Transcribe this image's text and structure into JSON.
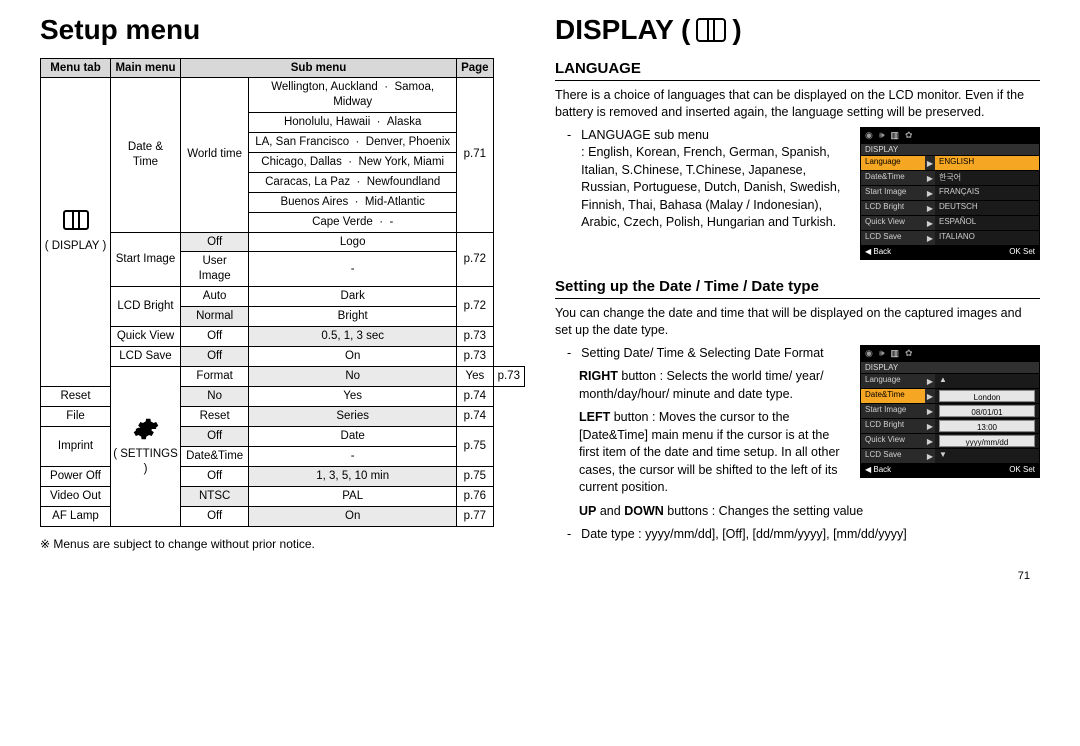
{
  "page_number": "71",
  "left": {
    "title": "Setup menu",
    "headers": [
      "Menu tab",
      "Main menu",
      "Sub menu",
      "Page"
    ],
    "display_tab_label": "( DISPLAY )",
    "display_rows": {
      "date_time": {
        "main": "Date & Time",
        "sub_main": "World time",
        "cities": [
          [
            "Wellington, Auckland",
            "Samoa, Midway"
          ],
          [
            "Honolulu, Hawaii",
            "Alaska"
          ],
          [
            "LA, San Francisco",
            "Denver, Phoenix"
          ],
          [
            "Chicago, Dallas",
            "New York, Miami"
          ],
          [
            "Caracas, La Paz",
            "Newfoundland"
          ],
          [
            "Buenos Aires",
            "Mid-Atlantic"
          ],
          [
            "Cape Verde",
            "-"
          ]
        ],
        "page": "p.71"
      },
      "start_image": {
        "main": "Start Image",
        "r1": [
          "Off",
          "Logo"
        ],
        "r2": [
          "User Image",
          "-"
        ],
        "page": "p.72"
      },
      "lcd_bright": {
        "main": "LCD Bright",
        "r1": [
          "Auto",
          "Dark"
        ],
        "r2": [
          "Normal",
          "Bright"
        ],
        "page": "p.72"
      },
      "quick_view": {
        "main": "Quick View",
        "r1": [
          "Off",
          "0.5, 1, 3 sec"
        ],
        "page": "p.73"
      },
      "lcd_save": {
        "main": "LCD Save",
        "r1": [
          "Off",
          "On"
        ],
        "page": "p.73"
      }
    },
    "settings_tab_label": "( SETTINGS )",
    "settings_rows": {
      "format": {
        "main": "Format",
        "r1": [
          "No",
          "Yes"
        ],
        "page": "p.73"
      },
      "reset": {
        "main": "Reset",
        "r1": [
          "No",
          "Yes"
        ],
        "page": "p.74"
      },
      "file": {
        "main": "File",
        "r1": [
          "Reset",
          "Series"
        ],
        "page": "p.74"
      },
      "imprint": {
        "main": "Imprint",
        "r1": [
          "Off",
          "Date"
        ],
        "r2": [
          "Date&Time",
          "-"
        ],
        "page": "p.75"
      },
      "power_off": {
        "main": "Power Off",
        "r1": [
          "Off",
          "1, 3, 5, 10 min"
        ],
        "page": "p.75"
      },
      "video_out": {
        "main": "Video Out",
        "r1": [
          "NTSC",
          "PAL"
        ],
        "page": "p.76"
      },
      "af_lamp": {
        "main": "AF Lamp",
        "r1": [
          "Off",
          "On"
        ],
        "page": "p.77"
      }
    },
    "note": "※  Menus are subject to change without prior notice."
  },
  "right": {
    "title": "DISPLAY (",
    "title_close": ")",
    "language": {
      "heading": "LANGUAGE",
      "para": "There is a choice of languages that can be displayed on the LCD monitor. Even if the battery is removed and inserted again, the language setting will be preserved.",
      "bullet_label": "LANGUAGE sub menu",
      "bullet_body": ": English, Korean, French, German, Spanish, Italian, S.Chinese, T.Chinese, Japanese, Russian, Portuguese, Dutch, Danish, Swedish, Finnish, Thai, Bahasa (Malay / Indonesian), Arabic, Czech, Polish, Hungarian and Turkish.",
      "lcd": {
        "title": "DISPLAY",
        "items": [
          {
            "label": "Language",
            "value": "ENGLISH",
            "active": true,
            "valActive": true
          },
          {
            "label": "Date&Time",
            "value": "한국어"
          },
          {
            "label": "Start Image",
            "value": "FRANÇAIS"
          },
          {
            "label": "LCD Bright",
            "value": "DEUTSCH"
          },
          {
            "label": "Quick View",
            "value": "ESPAÑOL"
          },
          {
            "label": "LCD Save",
            "value": "ITALIANO"
          }
        ],
        "foot_left": "◀  Back",
        "foot_right": "OK  Set"
      }
    },
    "datetime": {
      "heading": "Setting up the Date / Time / Date type",
      "para": "You can change the date and time that will be displayed on the captured images and set up the date type.",
      "b1": "Setting Date/ Time & Selecting Date Format",
      "b2a": "RIGHT",
      "b2b": " button : Selects the world time/ year/ month/day/hour/ minute and date type.",
      "b3a": "LEFT",
      "b3b": " button    : Moves the cursor to the [Date&Time] main menu if the cursor is at the first item of the date and time setup. In all other cases, the cursor will be shifted to the left of its current position.",
      "b4a": "UP",
      "b4b": " and ",
      "b4c": "DOWN",
      "b4d": " buttons : Changes the setting value",
      "b5": "Date type : yyyy/mm/dd], [Off], [dd/mm/yyyy], [mm/dd/yyyy]",
      "lcd": {
        "title": "DISPLAY",
        "items": [
          {
            "label": "Language",
            "value": "▲",
            "arrowVal": true
          },
          {
            "label": "Date&Time",
            "value": "London",
            "active": true,
            "box": true
          },
          {
            "label": "Start Image",
            "value": "08/01/01",
            "box": true
          },
          {
            "label": "LCD Bright",
            "value": "13:00",
            "box": true
          },
          {
            "label": "Quick View",
            "value": "yyyy/mm/dd",
            "box": true
          },
          {
            "label": "LCD Save",
            "value": "▼",
            "arrowVal": true
          }
        ],
        "foot_left": "◀  Back",
        "foot_right": "OK  Set"
      }
    }
  }
}
